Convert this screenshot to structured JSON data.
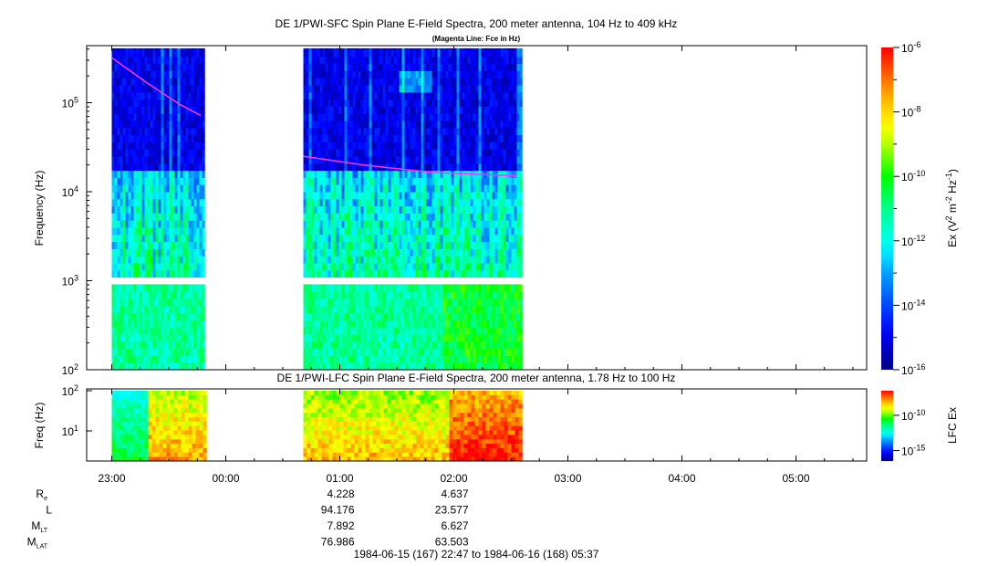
{
  "chart_data": [
    {
      "type": "heatmap",
      "title": "DE 1/PWI-SFC  Spin Plane E-Field Spectra, 200 meter antenna, 104 Hz to 409 kHz",
      "subtitle": "(Magenta Line: Fce in Hz)",
      "ylabel": "Frequency (Hz)",
      "yscale": "log",
      "ylim": [
        100,
        409000
      ],
      "yticks": [
        {
          "v": 100,
          "label": "10",
          "exp": "2"
        },
        {
          "v": 1000,
          "label": "10",
          "exp": "3"
        },
        {
          "v": 10000,
          "label": "10",
          "exp": "4"
        },
        {
          "v": 100000,
          "label": "10",
          "exp": "5"
        }
      ],
      "colorbar": {
        "label": "Ex (V",
        "label_parts": [
          "Ex (V",
          "2",
          " m",
          "-2",
          " Hz",
          "-1",
          ")"
        ],
        "range_log10": [
          -16,
          -6
        ],
        "ticks": [
          {
            "label": "10",
            "exp": "-6",
            "v": -6
          },
          {
            "label": "10",
            "exp": "-8",
            "v": -8
          },
          {
            "label": "10",
            "exp": "-10",
            "v": -10
          },
          {
            "label": "10",
            "exp": "-12",
            "v": -12
          },
          {
            "label": "10",
            "exp": "-14",
            "v": -14
          },
          {
            "label": "10",
            "exp": "-16",
            "v": -16
          }
        ]
      },
      "data_segments_hours": [
        [
          23.0,
          23.8
        ],
        [
          24.68,
          26.58
        ]
      ],
      "gap_hz": [
        900,
        1000
      ],
      "fce_line": {
        "color": "#ff33ff",
        "segments": [
          [
            [
              23.0,
              320000
            ],
            [
              23.3,
              170000
            ],
            [
              23.6,
              95000
            ],
            [
              23.78,
              72000
            ]
          ],
          [
            [
              24.68,
              25000
            ],
            [
              25.2,
              20000
            ],
            [
              25.8,
              16500
            ],
            [
              26.55,
              15000
            ]
          ]
        ]
      }
    },
    {
      "type": "heatmap",
      "title": "DE 1/PWI-LFC  Spin Plane E-Field Spectra, 200 meter antenna, 1.78 Hz to 100 Hz",
      "ylabel": "Freq (Hz)",
      "yscale": "log",
      "ylim": [
        1.78,
        100
      ],
      "yticks": [
        {
          "v": 100,
          "label": "10",
          "exp": "2"
        },
        {
          "v": 10,
          "label": "10",
          "exp": "1"
        }
      ],
      "colorbar": {
        "label": "LFC Ex",
        "range_log10": [
          -16.5,
          -6.5
        ],
        "ticks": [
          {
            "label": "10",
            "exp": "-10",
            "v": -10
          },
          {
            "label": "10",
            "exp": "-15",
            "v": -15
          }
        ]
      },
      "data_segments_hours": [
        [
          23.0,
          23.8
        ],
        [
          24.68,
          26.58
        ]
      ]
    }
  ],
  "xaxis": {
    "range_hours": [
      22.78,
      29.62
    ],
    "ticks": [
      {
        "v": 23,
        "label": "23:00"
      },
      {
        "v": 24,
        "label": "00:00"
      },
      {
        "v": 25,
        "label": "01:00"
      },
      {
        "v": 26,
        "label": "02:00"
      },
      {
        "v": 27,
        "label": "03:00"
      },
      {
        "v": 28,
        "label": "04:00"
      },
      {
        "v": 29,
        "label": "05:00"
      }
    ]
  },
  "ephemeris": {
    "rows": [
      {
        "label": "R",
        "sub": "e",
        "values": [
          "",
          "",
          "4.228",
          "4.637",
          "",
          "",
          ""
        ]
      },
      {
        "label": "L",
        "sub": "",
        "values": [
          "",
          "",
          "94.176",
          "23.577",
          "",
          "",
          ""
        ]
      },
      {
        "label": "M",
        "sub": "LT",
        "values": [
          "",
          "",
          "7.892",
          "6.627",
          "",
          "",
          ""
        ]
      },
      {
        "label": "M",
        "sub": "LAT",
        "values": [
          "",
          "",
          "76.986",
          "63.503",
          "",
          "",
          ""
        ]
      }
    ],
    "time_range": "1984-06-15 (167) 22:47 to 1984-06-16 (168) 05:37"
  }
}
